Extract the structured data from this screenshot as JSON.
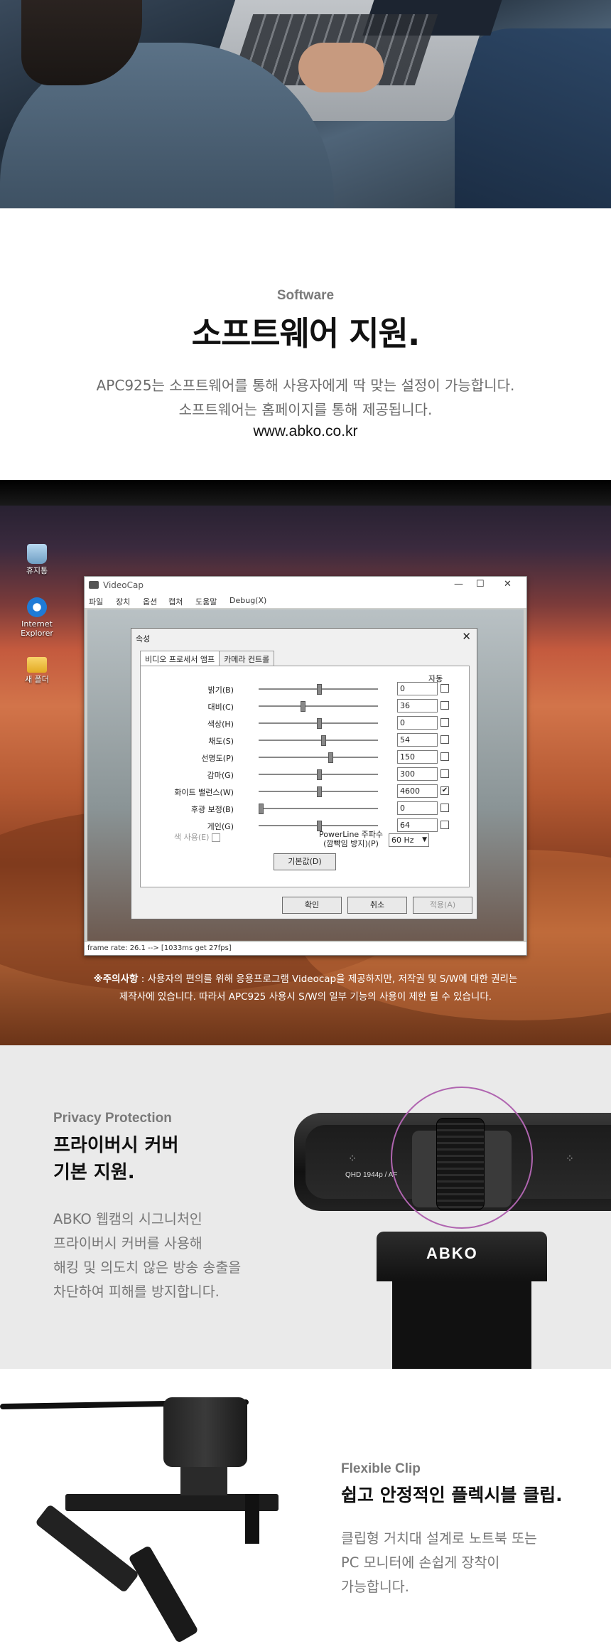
{
  "software": {
    "eyebrow": "Software",
    "title": "소프트웨어 지원.",
    "desc_line1": "APC925는 소프트웨어를 통해 사용자에게 딱 맞는 설정이 가능합니다.",
    "desc_line2": "소프트웨어는 홈페이지를 통해 제공됩니다.",
    "url": "www.abko.co.kr"
  },
  "desktop": {
    "icons": [
      {
        "label": "휴지통",
        "icon": "recycle-bin-icon"
      },
      {
        "label": "Internet Explorer",
        "icon": "internet-explorer-icon"
      },
      {
        "label": "새 폴더",
        "icon": "folder-icon"
      }
    ],
    "window": {
      "title": "VideoCap",
      "minimize": "—",
      "maximize": "☐",
      "close": "✕",
      "menu": [
        "파일",
        "장치",
        "옵션",
        "캡쳐",
        "도움말",
        "Debug(X)"
      ],
      "status": "frame rate: 26.1 --> [1033ms get 27fps]"
    },
    "dialog": {
      "title": "속성",
      "close": "✕",
      "tabs": [
        "비디오 프로세서 앰프",
        "카메라 컨트롤"
      ],
      "auto_label": "자동",
      "properties": [
        {
          "label": "밝기(B)",
          "value": "0",
          "level": 0.5,
          "checked": false
        },
        {
          "label": "대비(C)",
          "value": "36",
          "level": 0.36,
          "checked": false
        },
        {
          "label": "색상(H)",
          "value": "0",
          "level": 0.5,
          "checked": false
        },
        {
          "label": "채도(S)",
          "value": "54",
          "level": 0.54,
          "checked": false
        },
        {
          "label": "선명도(P)",
          "value": "150",
          "level": 0.6,
          "checked": false
        },
        {
          "label": "감마(G)",
          "value": "300",
          "level": 0.5,
          "checked": false
        },
        {
          "label": "화이트 밸런스(W)",
          "value": "4600",
          "level": 0.5,
          "checked": true
        },
        {
          "label": "후광 보정(B)",
          "value": "0",
          "level": 0.0,
          "checked": false
        },
        {
          "label": "게인(G)",
          "value": "64",
          "level": 0.5,
          "checked": false
        }
      ],
      "color_enable": "색 사용(E)",
      "powerline_label_1": "PowerLine 주파수",
      "powerline_label_2": "(깜빡임 방지)(P)",
      "powerline_value": "60 Hz",
      "default_button": "기본값(D)",
      "ok_button": "확인",
      "cancel_button": "취소",
      "apply_button": "적용(A)"
    },
    "note_bold": "※주의사항",
    "note_line1": " : 사용자의 편의를 위해 응용프로그램 Videocap을 제공하지만, 저작권 및 S/W에 대한 권리는",
    "note_line2": "제작사에 있습니다. 따라서 APC925 사용시 S/W의 일부 기능의 사용이 제한 될 수 있습니다."
  },
  "privacy": {
    "eyebrow": "Privacy Protection",
    "title_line1": "프라이버시 커버",
    "title_line2": "기본 지원.",
    "body": [
      "ABKO 웹캠의 시그니처인",
      "프라이버시 커버를 사용해",
      "해킹 및 의도치 않은 방송 송출을",
      "차단하여 피해를 방지합니다."
    ],
    "cam_label": "QHD 1944p / AF",
    "logo": "ABKO"
  },
  "flex": {
    "eyebrow": "Flexible Clip",
    "title": "쉽고 안정적인 플렉시블 클립.",
    "body": [
      "클립형 거치대 설계로 노트북 또는",
      "PC 모니터에 손쉽게 장착이",
      "가능합니다."
    ]
  }
}
